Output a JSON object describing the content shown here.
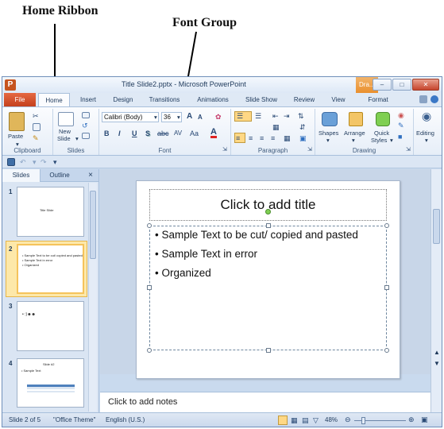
{
  "annotations": {
    "home_ribbon": "Home Ribbon",
    "font_group": "Font Group"
  },
  "window": {
    "title": "Title Slide2.pptx  -  Microsoft PowerPoint",
    "context_tab": "Dra..."
  },
  "tabs": [
    "File",
    "Home",
    "Insert",
    "Design",
    "Transitions",
    "Animations",
    "Slide Show",
    "Review",
    "View",
    "Format"
  ],
  "ribbon": {
    "clipboard": {
      "paste": "Paste",
      "label": "Clipboard"
    },
    "slides": {
      "new_slide_line1": "New",
      "new_slide_line2": "Slide",
      "label": "Slides"
    },
    "font": {
      "font_name": "Calibri (Body)",
      "font_size": "36",
      "grow": "A",
      "shrink": "A",
      "bold": "B",
      "italic": "I",
      "underline": "U",
      "shadow": "S",
      "strike": "abc",
      "spacing": "AV",
      "change_case": "Aa",
      "font_color": "A",
      "label": "Font"
    },
    "paragraph": {
      "label": "Paragraph"
    },
    "drawing": {
      "shapes": "Shapes",
      "arrange": "Arrange",
      "quick_styles_line1": "Quick",
      "quick_styles_line2": "Styles",
      "label": "Drawing"
    },
    "editing": {
      "editing": "Editing"
    }
  },
  "slide_panel": {
    "tabs": [
      "Slides",
      "Outline"
    ],
    "close": "×",
    "thumbnails": [
      {
        "number": "1",
        "lines": [
          "Title Slide"
        ]
      },
      {
        "number": "2",
        "lines": [
          "• Sample Text to be cut/ copied and pasted",
          "• Sample Text in error",
          "• Organized"
        ]
      },
      {
        "number": "3",
        "lines": [
          "• :)☻☻"
        ]
      },
      {
        "number": "4",
        "lines": [
          "Slide #2",
          "• Sample Text"
        ]
      }
    ]
  },
  "slide": {
    "title_placeholder": "Click to add title",
    "bullets": [
      "Sample Text to be cut/ copied and pasted",
      "Sample Text in error",
      "Organized"
    ]
  },
  "notes": {
    "placeholder": "Click to add notes"
  },
  "status": {
    "slide_position": "Slide 2 of 5",
    "theme": "\"Office Theme\"",
    "language": "English (U.S.)",
    "zoom": "48%"
  },
  "colors": {
    "file_tab": "#c4401c",
    "ribbon_bg": "#fbfcfe",
    "window_frame": "#6f8fba",
    "selection": "#ffd885"
  }
}
